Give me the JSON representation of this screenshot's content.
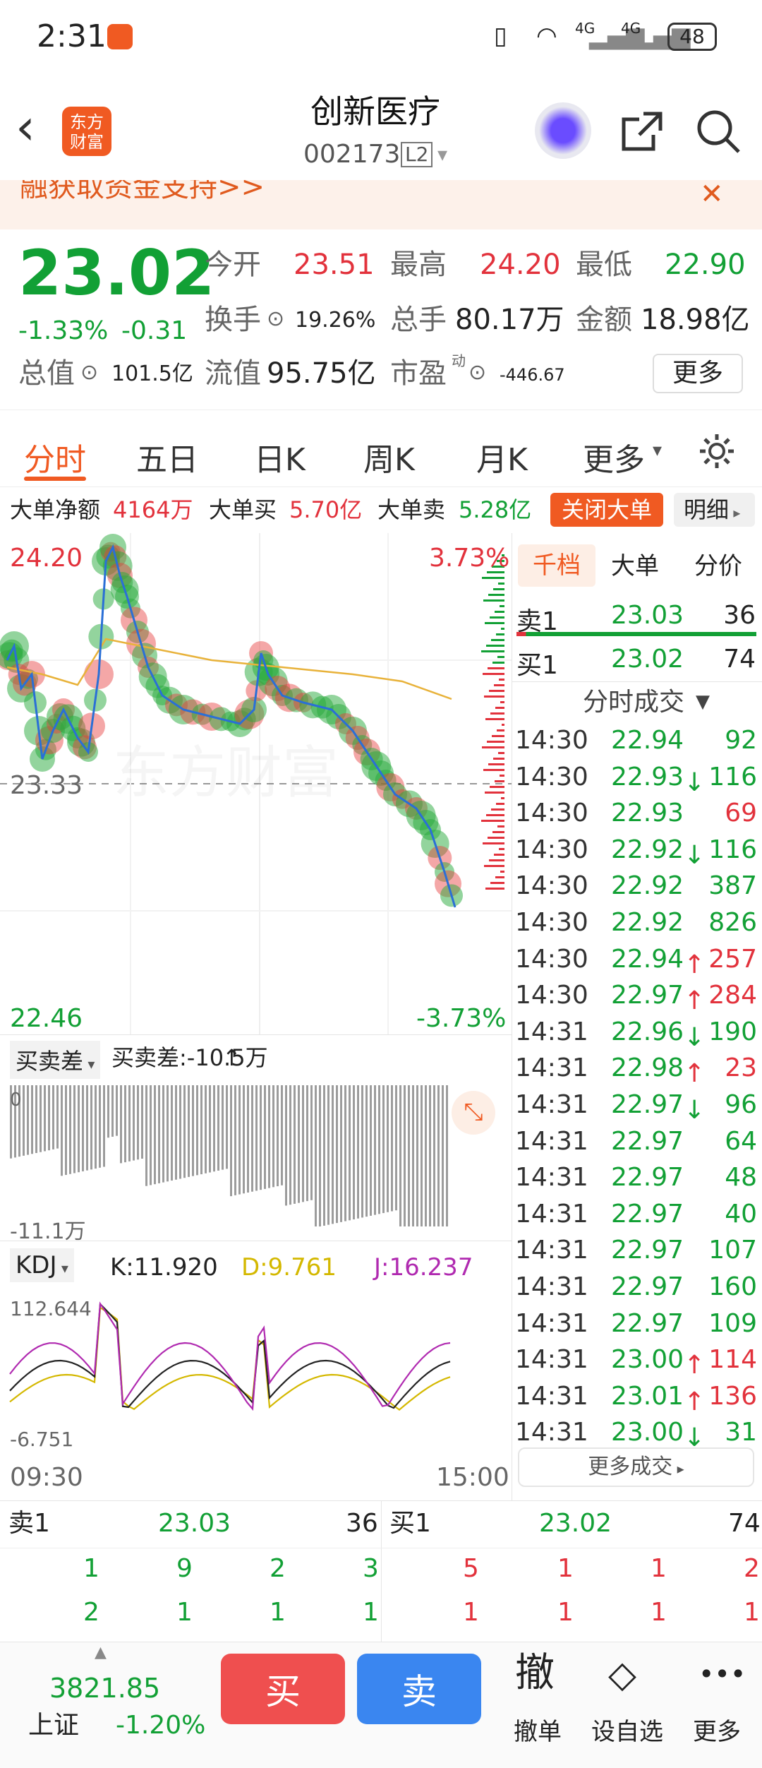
{
  "status": {
    "time": "2:31",
    "battery": "48",
    "net1": "4G",
    "net2": "4G"
  },
  "nav": {
    "title": "创新医疗",
    "code": "002173",
    "badge": "L2",
    "logo1": "东方",
    "logo2": "财富"
  },
  "banner": {
    "text": "融获取资金支持>>"
  },
  "quote": {
    "price": "23.02",
    "pct": "-1.33%",
    "chg": "-0.31",
    "open_l": "今开",
    "open": "23.51",
    "high_l": "最高",
    "high": "24.20",
    "low_l": "最低",
    "low": "22.90",
    "turn_l": "换手",
    "turn": "19.26%",
    "vol_l": "总手",
    "vol": "80.17万",
    "amt_l": "金额",
    "amt": "18.98亿",
    "cap_l": "总值",
    "cap": "101.5亿",
    "fcap_l": "流值",
    "fcap": "95.75亿",
    "pe_l": "市盈",
    "pe_sup": "动",
    "pe": "-446.67",
    "more": "更多"
  },
  "tabs": [
    "分时",
    "五日",
    "日K",
    "周K",
    "月K",
    "更多"
  ],
  "flow": {
    "net_l": "大单净额",
    "net": "4164万",
    "buy_l": "大单买",
    "buy": "5.70亿",
    "sell_l": "大单卖",
    "sell": "5.28亿",
    "close": "关闭大单",
    "detail": "明细"
  },
  "chart_data": {
    "type": "line",
    "top": "24.20",
    "top_pct": "3.73%",
    "mid": "23.33",
    "bottom": "22.46",
    "bottom_pct": "-3.73%",
    "ind1_label": "买卖差",
    "ind1_val": "买卖差:-10.5万",
    "ind1_top": "0",
    "ind1_bottom": "-11.1万",
    "kdj_label": "KDJ",
    "k": "K:11.920",
    "d": "D:9.761",
    "j": "J:16.237",
    "kdj_top": "112.644",
    "kdj_bottom": "-6.751",
    "t_start": "09:30",
    "t_end": "15:00",
    "colors": {
      "price": "#2a6fd6",
      "avg": "#e8b23a",
      "k": "#222",
      "d": "#d4b800",
      "j": "#b02ab0"
    }
  },
  "side": {
    "tabs": [
      "千档",
      "大单",
      "分价"
    ],
    "sell1": {
      "l": "卖1",
      "p": "23.03",
      "v": "36"
    },
    "buy1": {
      "l": "买1",
      "p": "23.02",
      "v": "74"
    },
    "trades_title": "分时成交",
    "trades": [
      {
        "t": "14:30",
        "p": "22.94",
        "a": "",
        "v": "92",
        "c": "green"
      },
      {
        "t": "14:30",
        "p": "22.93",
        "a": "↓",
        "v": "116",
        "c": "green"
      },
      {
        "t": "14:30",
        "p": "22.93",
        "a": "",
        "v": "69",
        "c": "red"
      },
      {
        "t": "14:30",
        "p": "22.92",
        "a": "↓",
        "v": "116",
        "c": "green"
      },
      {
        "t": "14:30",
        "p": "22.92",
        "a": "",
        "v": "387",
        "c": "green"
      },
      {
        "t": "14:30",
        "p": "22.92",
        "a": "",
        "v": "826",
        "c": "green"
      },
      {
        "t": "14:30",
        "p": "22.94",
        "a": "↑",
        "v": "257",
        "c": "red"
      },
      {
        "t": "14:30",
        "p": "22.97",
        "a": "↑",
        "v": "284",
        "c": "red"
      },
      {
        "t": "14:31",
        "p": "22.96",
        "a": "↓",
        "v": "190",
        "c": "green"
      },
      {
        "t": "14:31",
        "p": "22.98",
        "a": "↑",
        "v": "23",
        "c": "red"
      },
      {
        "t": "14:31",
        "p": "22.97",
        "a": "↓",
        "v": "96",
        "c": "green"
      },
      {
        "t": "14:31",
        "p": "22.97",
        "a": "",
        "v": "64",
        "c": "green"
      },
      {
        "t": "14:31",
        "p": "22.97",
        "a": "",
        "v": "48",
        "c": "green"
      },
      {
        "t": "14:31",
        "p": "22.97",
        "a": "",
        "v": "40",
        "c": "green"
      },
      {
        "t": "14:31",
        "p": "22.97",
        "a": "",
        "v": "107",
        "c": "green"
      },
      {
        "t": "14:31",
        "p": "22.97",
        "a": "",
        "v": "160",
        "c": "green"
      },
      {
        "t": "14:31",
        "p": "22.97",
        "a": "",
        "v": "109",
        "c": "green"
      },
      {
        "t": "14:31",
        "p": "23.00",
        "a": "↑",
        "v": "114",
        "c": "red"
      },
      {
        "t": "14:31",
        "p": "23.01",
        "a": "↑",
        "v": "136",
        "c": "red"
      },
      {
        "t": "14:31",
        "p": "23.00",
        "a": "↓",
        "v": "31",
        "c": "green"
      }
    ],
    "more_trades": "更多成交"
  },
  "book": {
    "sell": {
      "l": "卖1",
      "p": "23.03",
      "v": "36",
      "r1": [
        "1",
        "9",
        "2",
        "3"
      ],
      "r2": [
        "2",
        "1",
        "1",
        "1"
      ]
    },
    "buy": {
      "l": "买1",
      "p": "23.02",
      "v": "74",
      "r1": [
        "5",
        "1",
        "1",
        "2"
      ],
      "r2": [
        "1",
        "1",
        "1",
        "1"
      ]
    }
  },
  "bottom": {
    "index_val": "3821.85",
    "index_name": "上证",
    "index_pct": "-1.20%",
    "buy": "买",
    "sell": "卖",
    "actions": [
      {
        "icon": "撤",
        "label": "撤单"
      },
      {
        "icon": "◇",
        "label": "设自选"
      },
      {
        "icon": "•••",
        "label": "更多"
      }
    ]
  }
}
